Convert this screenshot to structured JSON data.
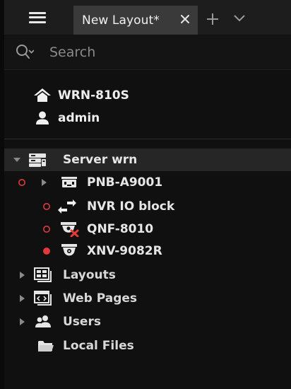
{
  "tab": {
    "title": "New Layout*"
  },
  "search": {
    "placeholder": "Search"
  },
  "system": {
    "name": "WRN-810S",
    "user": "admin"
  },
  "tree": {
    "server": {
      "label": "Server wrn",
      "expanded": true
    },
    "devices": [
      {
        "label": "PNB-A9001",
        "status": "offline",
        "status_color": "#e03a3a",
        "icon": "encoder-icon",
        "expandable": true
      },
      {
        "label": "NVR IO block",
        "status": "offline",
        "status_color": "#e03a3a",
        "icon": "io-transfer-icon",
        "expandable": false
      },
      {
        "label": "QNF-8010",
        "status": "offline",
        "status_color": "#e03a3a",
        "icon": "camera-error-icon",
        "expandable": false
      },
      {
        "label": "XNV-9082R",
        "status": "recording",
        "status_color": "#e03a3a",
        "icon": "dome-camera-icon",
        "expandable": false
      }
    ],
    "groups": [
      {
        "label": "Layouts",
        "icon": "layouts-icon"
      },
      {
        "label": "Web Pages",
        "icon": "web-pages-icon"
      },
      {
        "label": "Users",
        "icon": "users-icon"
      },
      {
        "label": "Local Files",
        "icon": "folder-icon"
      }
    ]
  },
  "colors": {
    "background": "#101010",
    "tab_active": "#3a3a3a",
    "selected_row": "#262626",
    "status_red": "#e03a3a",
    "text": "#e6e6e6",
    "muted": "#8a8a8a"
  }
}
